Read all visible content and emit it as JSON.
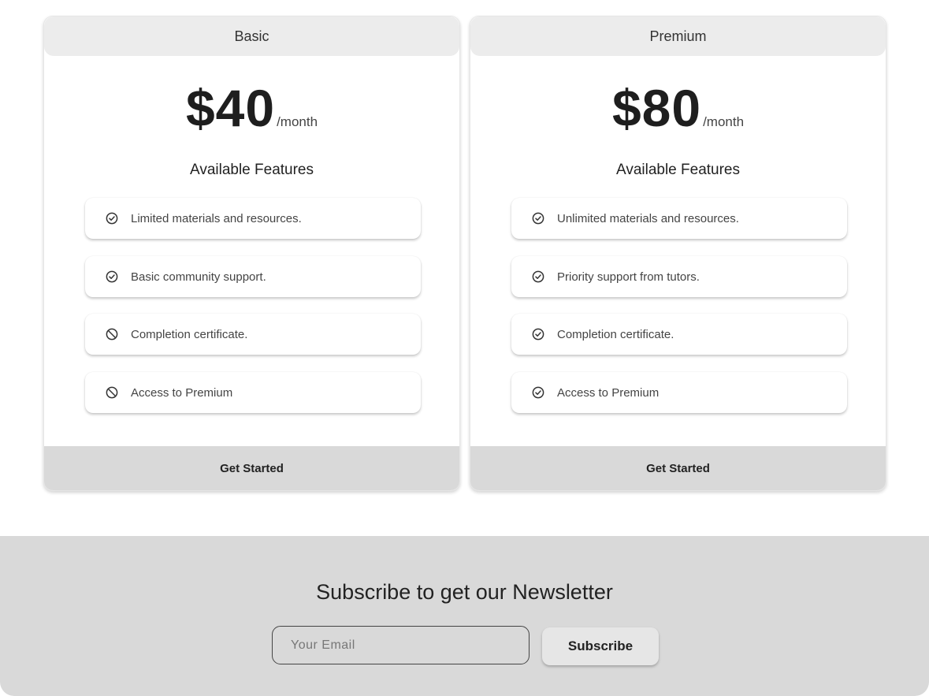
{
  "plans": [
    {
      "name": "Basic",
      "price": "$40",
      "period": "/month",
      "features_title": "Available Features",
      "features": [
        {
          "text": "Limited materials and resources.",
          "icon": "check-circle-icon"
        },
        {
          "text": "Basic community support.",
          "icon": "check-circle-icon"
        },
        {
          "text": "Completion certificate.",
          "icon": "ban-icon"
        },
        {
          "text": "Access to Premium",
          "icon": "ban-icon"
        }
      ],
      "cta_label": "Get Started"
    },
    {
      "name": "Premium",
      "price": "$80",
      "period": "/month",
      "features_title": "Available Features",
      "features": [
        {
          "text": "Unlimited materials and resources.",
          "icon": "check-circle-icon"
        },
        {
          "text": "Priority support from tutors.",
          "icon": "check-circle-icon"
        },
        {
          "text": "Completion certificate.",
          "icon": "check-circle-icon"
        },
        {
          "text": "Access to Premium",
          "icon": "check-circle-icon"
        }
      ],
      "cta_label": "Get Started"
    }
  ],
  "newsletter": {
    "title": "Subscribe to get our Newsletter",
    "email_placeholder": "Your Email",
    "email_value": "",
    "button_label": "Subscribe"
  },
  "colors": {
    "header_bg": "#ececec",
    "cta_bg": "#d9d9d9",
    "newsletter_bg": "#d9d9d9",
    "text": "#222222"
  }
}
